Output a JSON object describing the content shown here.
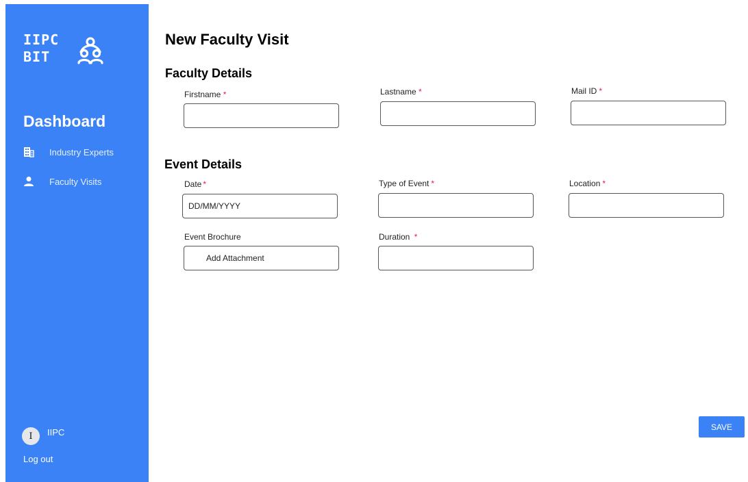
{
  "sidebar": {
    "logo_line1": "IIPC",
    "logo_line2": "BIT",
    "title": "Dashboard",
    "nav": [
      {
        "label": "Industry Experts",
        "icon": "building-icon"
      },
      {
        "label": "Faculty Visits",
        "icon": "person-icon"
      }
    ],
    "user": {
      "avatar_initial": "I",
      "name": "IIPC"
    },
    "logout_label": "Log out"
  },
  "main": {
    "page_title": "New Faculty Visit",
    "faculty_section": {
      "title": "Faculty Details",
      "fields": [
        {
          "label": "Firstname",
          "required_mark": "*",
          "value": ""
        },
        {
          "label": "Lastname",
          "required_mark": "*",
          "value": ""
        },
        {
          "label": "Mail ID",
          "required_mark": "*",
          "value": ""
        }
      ]
    },
    "event_section": {
      "title": "Event Details",
      "fields": [
        {
          "label": "Date",
          "required_mark": "*",
          "placeholder": "DD/MM/YYYY",
          "value": ""
        },
        {
          "label": "Type of Event",
          "required_mark": "*",
          "value": ""
        },
        {
          "label": "Location",
          "required_mark": "*",
          "value": ""
        },
        {
          "label": "Event Brochure",
          "button_label": "Add Attachment"
        },
        {
          "label": "Duration",
          "required_mark": "*",
          "value": ""
        }
      ]
    },
    "save_label": "SAVE"
  },
  "colors": {
    "accent": "#3b82f6",
    "required": "#e11d48"
  }
}
